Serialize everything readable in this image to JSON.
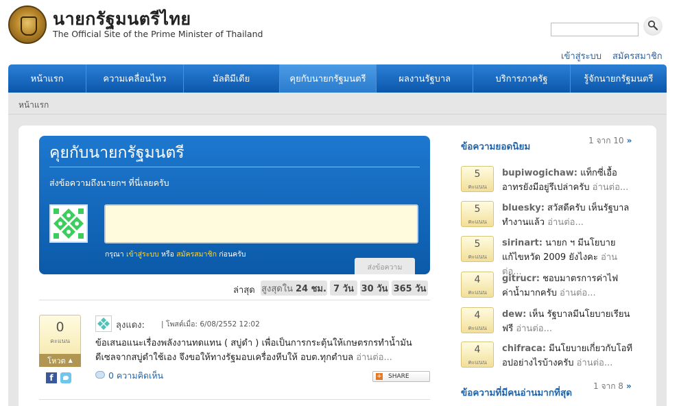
{
  "header": {
    "title": "นายกรัฐมนตรีไทย",
    "subtitle": "The Official Site of the Prime Minister of Thailand",
    "search_placeholder": "",
    "login_link": "เข้าสู่ระบบ",
    "register_link": "สมัครสมาชิก"
  },
  "nav": {
    "items": [
      {
        "label": "หน้าแรก",
        "active": false
      },
      {
        "label": "ความเคลื่อนไหว",
        "active": false
      },
      {
        "label": "มัลติมีเดีย",
        "active": false
      },
      {
        "label": "คุยกับนายกรัฐมนตรี",
        "active": true
      },
      {
        "label": "ผลงานรัฐบาล",
        "active": false
      },
      {
        "label": "บริการภาครัฐ",
        "active": false
      },
      {
        "label": "รู้จักนายกรัฐมนตรี",
        "active": false
      }
    ]
  },
  "breadcrumb": "หน้าแรก",
  "talk": {
    "title": "คุยกับนายกรัฐมนตรี",
    "subtitle": "ส่งข้อความถึงนายกฯ ที่นี่เลยครับ",
    "textarea_value": "",
    "note_prefix": "กรุณา",
    "note_login": "เข้าสู่ระบบ",
    "note_or": "หรือ",
    "note_register": "สมัครสมาชิก",
    "note_suffix": "ก่อนครับ",
    "send_label": "ส่งข้อความ"
  },
  "filters": {
    "label": "ล่าสุด",
    "tabs": [
      {
        "prefix": "สูงสุดใน",
        "value": "24 ชม."
      },
      {
        "prefix": "",
        "value": "7 วัน"
      },
      {
        "prefix": "",
        "value": "30 วัน"
      },
      {
        "prefix": "",
        "value": "365 วัน"
      }
    ]
  },
  "post": {
    "score": "0",
    "score_unit": "คะแนน",
    "vote_label": "โหวต",
    "author": "ลุงแดง:",
    "meta": "| โพสต์เมื่อ: 6/08/2552 12:02",
    "body": "ข้อเสนอแนะเรื่องพลังงานทดแทน ( สบู่ดำ ) เพื่อเป็นการกระตุ้นให้เกษตรกรทำน้ำมันดีเซลจากสบู่ดำใช้เอง จึงขอให้ทางรัฐมอบเครื่องหีบให้ อบต.ทุกตำบล",
    "read_more": "อ่านต่อ...",
    "comments": "0 ความคิดเห็น",
    "share_label": "SHARE"
  },
  "sidebar": {
    "popular": {
      "heading": "ข้อความยอดนิยม",
      "pager": "1 จาก 10",
      "pager_arrow": "»",
      "items": [
        {
          "score": "5",
          "unit": "คะแนน",
          "name": "bupiwogichaw:",
          "text": "แท็กซี่เอื้ออาทรยังมีอยู่รึเปล่าครับ",
          "more": "อ่านต่อ..."
        },
        {
          "score": "5",
          "unit": "คะแนน",
          "name": "bluesky:",
          "text": "สวัสดีครับ เห็นรัฐบาลทำงานแล้ว",
          "more": "อ่านต่อ..."
        },
        {
          "score": "5",
          "unit": "คะแนน",
          "name": "sirinart:",
          "text": "นายก ฯ มีนโยบายแก้ไขหวัด 2009 ยังไงคะ",
          "more": "อ่านต่อ..."
        },
        {
          "score": "4",
          "unit": "คะแนน",
          "name": "gitrucr:",
          "text": "ชอบมาตรการค่าไฟค่าน้ำมากครับ",
          "more": "อ่านต่อ..."
        },
        {
          "score": "4",
          "unit": "คะแนน",
          "name": "dew:",
          "text": "เห็น รัฐบาลมีนโยบายเรียนฟรี",
          "more": "อ่านต่อ..."
        },
        {
          "score": "4",
          "unit": "คะแนน",
          "name": "chifraca:",
          "text": "มีนโยบายเกี่ยวกับโอทีอปอย่างไรบ้างครับ",
          "more": "อ่านต่อ..."
        }
      ]
    },
    "most_read": {
      "heading": "ข้อความที่มีคนอ่านมากที่สุด",
      "pager": "1 จาก 8",
      "pager_arrow": "»"
    }
  }
}
